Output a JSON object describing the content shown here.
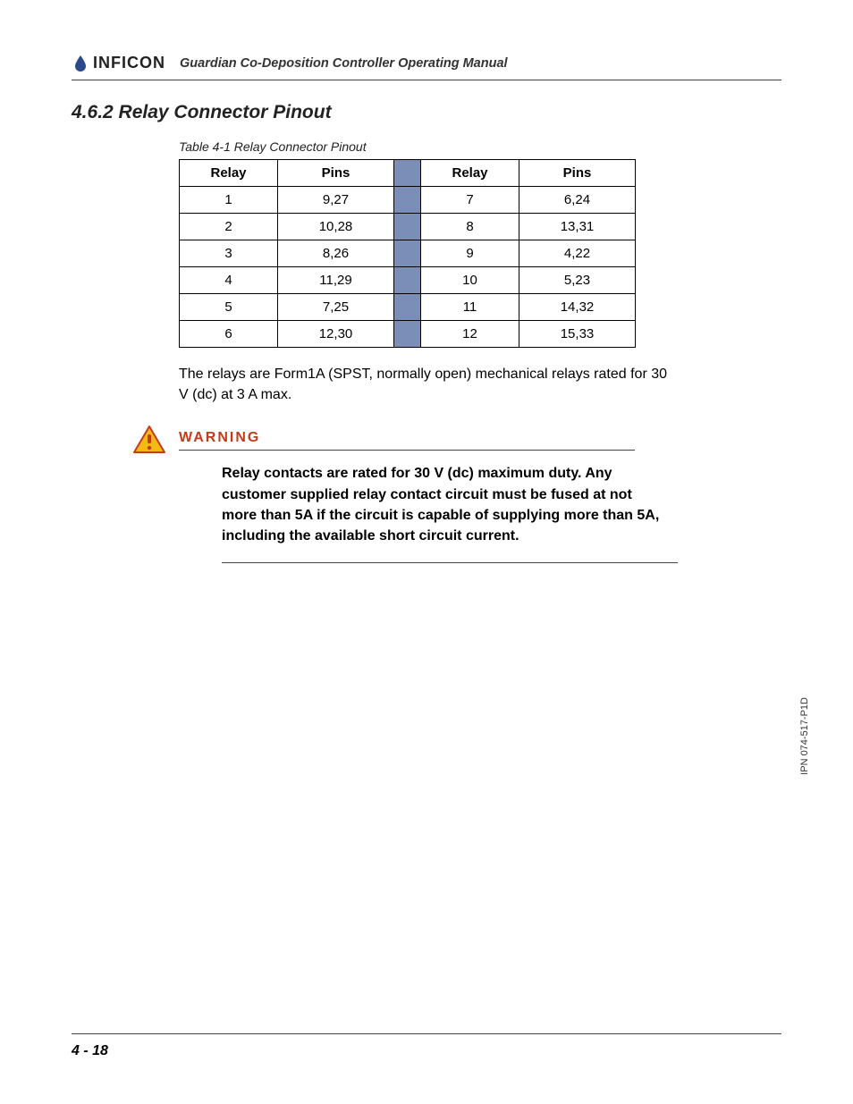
{
  "header": {
    "brand": "INFICON",
    "manual_title": "Guardian Co-Deposition Controller Operating Manual"
  },
  "section": {
    "number": "4.6.2",
    "title": "Relay Connector Pinout",
    "full_heading": "4.6.2  Relay Connector Pinout"
  },
  "table": {
    "caption": "Table 4-1  Relay Connector Pinout",
    "headers": {
      "relay": "Relay",
      "pins": "Pins"
    },
    "left_rows": [
      {
        "relay": "1",
        "pins": "9,27"
      },
      {
        "relay": "2",
        "pins": "10,28"
      },
      {
        "relay": "3",
        "pins": "8,26"
      },
      {
        "relay": "4",
        "pins": "11,29"
      },
      {
        "relay": "5",
        "pins": "7,25"
      },
      {
        "relay": "6",
        "pins": "12,30"
      }
    ],
    "right_rows": [
      {
        "relay": "7",
        "pins": "6,24"
      },
      {
        "relay": "8",
        "pins": "13,31"
      },
      {
        "relay": "9",
        "pins": "4,22"
      },
      {
        "relay": "10",
        "pins": "5,23"
      },
      {
        "relay": "11",
        "pins": "14,32"
      },
      {
        "relay": "12",
        "pins": "15,33"
      }
    ]
  },
  "body_text": "The relays are Form1A (SPST, normally open) mechanical relays rated for 30 V (dc) at 3 A max.",
  "warning": {
    "label": "WARNING",
    "text": "Relay contacts are rated for 30 V (dc) maximum duty. Any customer supplied relay contact circuit must be fused at not more than 5A if the circuit is capable of supplying more than 5A, including the available short circuit current."
  },
  "footer": {
    "page": "4 - 18",
    "doc_code": "IPN 074-517-P1D"
  }
}
